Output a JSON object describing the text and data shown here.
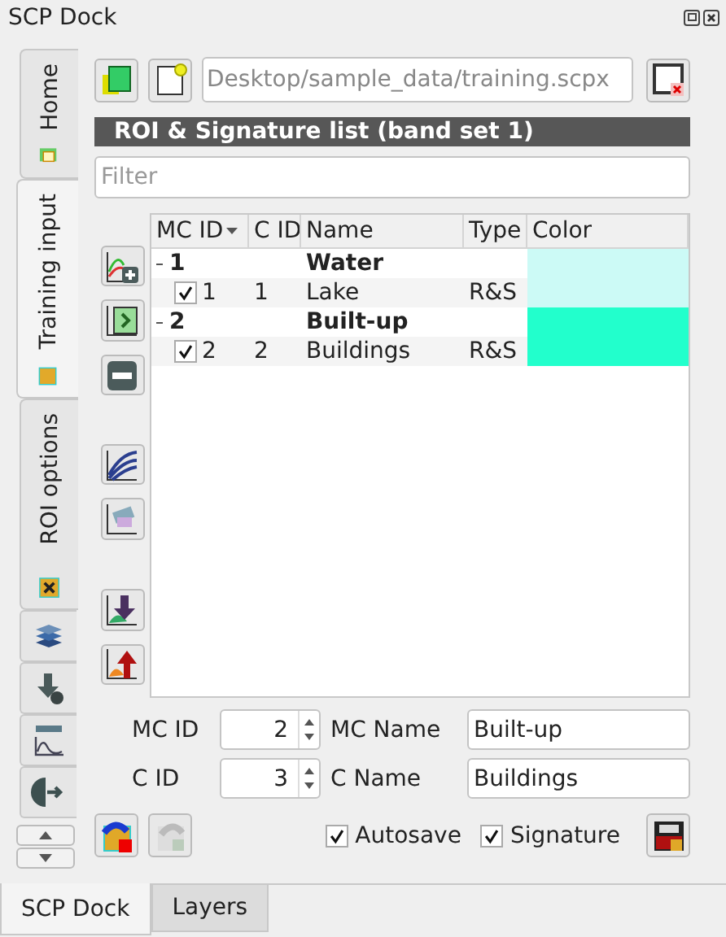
{
  "window": {
    "title": "SCP Dock"
  },
  "side_tabs": [
    {
      "label": "Home",
      "selected": false
    },
    {
      "label": "Training input",
      "selected": true
    },
    {
      "label": "ROI options",
      "selected": false
    }
  ],
  "file_field": {
    "value": "Desktop/sample_data/training.scpx"
  },
  "section_title": "ROI & Signature list (band set 1)",
  "filter": {
    "placeholder": "Filter"
  },
  "table": {
    "columns": [
      {
        "label": "MC ID",
        "sorted": true
      },
      {
        "label": "C ID",
        "sorted": false
      },
      {
        "label": "Name",
        "sorted": false
      },
      {
        "label": "Type",
        "sorted": false
      },
      {
        "label": "Color",
        "sorted": false
      }
    ],
    "groups": [
      {
        "mc_id": "1",
        "name": "Water",
        "color": "#ccfaf6",
        "expanded": true,
        "children": [
          {
            "checked": true,
            "mc_id": "1",
            "c_id": "1",
            "name": "Lake",
            "type": "R&S",
            "color": "#ccfaf6"
          }
        ]
      },
      {
        "mc_id": "2",
        "name": "Built-up",
        "color": "#22ffcc",
        "expanded": true,
        "children": [
          {
            "checked": true,
            "mc_id": "2",
            "c_id": "2",
            "name": "Buildings",
            "type": "R&S",
            "color": "#22ffcc"
          }
        ]
      }
    ]
  },
  "form": {
    "mc_id_label": "MC ID",
    "mc_id": "2",
    "mc_name_label": "MC Name",
    "mc_name": "Built-up",
    "c_id_label": "C ID",
    "c_id": "3",
    "c_name_label": "C Name",
    "c_name": "Buildings"
  },
  "options": [
    {
      "label": "Autosave",
      "checked": true
    },
    {
      "label": "Signature",
      "checked": true
    }
  ],
  "bottom_tabs": [
    {
      "label": "SCP Dock",
      "selected": true
    },
    {
      "label": "Layers",
      "selected": false
    }
  ]
}
